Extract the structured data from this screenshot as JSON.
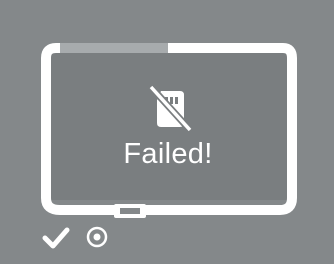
{
  "status": {
    "message": "Failed!",
    "main_icon": "no-sd-card-icon",
    "footer_icons": [
      "checkmark-icon",
      "radio-dot-icon"
    ]
  },
  "colors": {
    "background": "#84888a",
    "screen_fill": "#7a7e80",
    "frame": "#ffffff",
    "progress_track": "#a7abad"
  },
  "progress": {
    "fraction": 0.53
  }
}
